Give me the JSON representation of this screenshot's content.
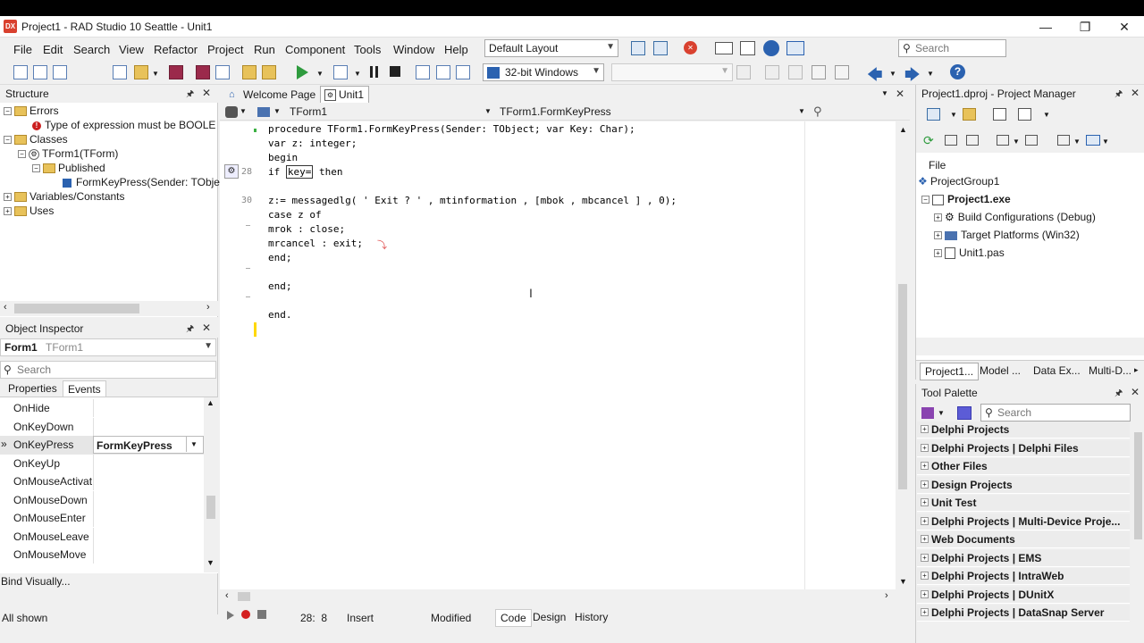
{
  "window": {
    "title": "Project1 - RAD Studio 10 Seattle - Unit1",
    "app_icon_text": "DX",
    "minimize_glyph": "—",
    "restore_glyph": "❐",
    "close_glyph": "✕"
  },
  "menu": [
    "File",
    "Edit",
    "Search",
    "View",
    "Refactor",
    "Project",
    "Run",
    "Component",
    "Tools",
    "Window",
    "Help"
  ],
  "layout_combo": "Default Layout",
  "platform_combo": "32-bit Windows",
  "config_combo": "",
  "top_search_placeholder": "Search",
  "structure": {
    "title": "Structure",
    "items": {
      "errors": "Errors",
      "error_msg": "Type of expression must be BOOLE",
      "classes": "Classes",
      "tform1": "TForm1(TForm)",
      "published": "Published",
      "formkeypress": "FormKeyPress(Sender: TObje",
      "variables": "Variables/Constants",
      "uses": "Uses"
    }
  },
  "object_inspector": {
    "title": "Object Inspector",
    "component_name": "Form1",
    "component_type": "TForm1",
    "search_placeholder": "Search",
    "tabs": [
      "Properties",
      "Events"
    ],
    "rows": [
      {
        "name": "OnHide",
        "value": ""
      },
      {
        "name": "OnKeyDown",
        "value": ""
      },
      {
        "name": "OnKeyPress",
        "value": "FormKeyPress"
      },
      {
        "name": "OnKeyUp",
        "value": ""
      },
      {
        "name": "OnMouseActivat",
        "value": ""
      },
      {
        "name": "OnMouseDown",
        "value": ""
      },
      {
        "name": "OnMouseEnter",
        "value": ""
      },
      {
        "name": "OnMouseLeave",
        "value": ""
      },
      {
        "name": "OnMouseMove",
        "value": ""
      }
    ],
    "bind_visually": "Bind Visually...",
    "all_shown": "All shown"
  },
  "editor": {
    "tabs": [
      "Welcome Page",
      "Unit1"
    ],
    "class_combo": "TForm1",
    "method_combo": "TForm1.FormKeyPress",
    "line_numbers": {
      "l28": "28",
      "l30": "30"
    },
    "lines": {
      "l1": "procedure TForm1.FormKeyPress(Sender: TObject; var Key: Char);",
      "l2": "var z: integer;",
      "l3": "begin",
      "l4a": "if ",
      "l4b": "key=",
      "l4c": " then",
      "l5": "z:= messagedlg( ' Exit ? ' , mtinformation , [mbok , mbcancel ] , 0);",
      "l6": "case z of",
      "l7": "mrok : close;",
      "l8": "mrcancel : exit;",
      "l9": "end;",
      "l10": "end;",
      "l11": "end."
    },
    "status": {
      "position": "28:  8",
      "mode": "Insert",
      "modified": "Modified",
      "view_tabs": [
        "Code",
        "Design",
        "History"
      ]
    }
  },
  "project_manager": {
    "title": "Project1.dproj - Project Manager",
    "file_label": "File",
    "group": "ProjectGroup1",
    "exe": "Project1.exe",
    "items": [
      "Build Configurations (Debug)",
      "Target Platforms (Win32)",
      "Unit1.pas"
    ],
    "bottom_tabs": [
      "Project1...",
      "Model ...",
      "Data Ex...",
      "Multi-D..."
    ]
  },
  "tool_palette": {
    "title": "Tool Palette",
    "search_placeholder": "Search",
    "categories": [
      "Delphi Projects",
      "Delphi Projects | Delphi Files",
      "Other Files",
      "Design Projects",
      "Unit Test",
      "Delphi Projects | Multi-Device Proje...",
      "Web Documents",
      "Delphi Projects | EMS",
      "Delphi Projects | IntraWeb",
      "Delphi Projects | DUnitX",
      "Delphi Projects | DataSnap Server"
    ]
  },
  "colors": {
    "accent_blue": "#0078d7",
    "keyword": "#000080",
    "gutter_modified": "#ffd800",
    "gutter_saved": "#3cb043"
  }
}
